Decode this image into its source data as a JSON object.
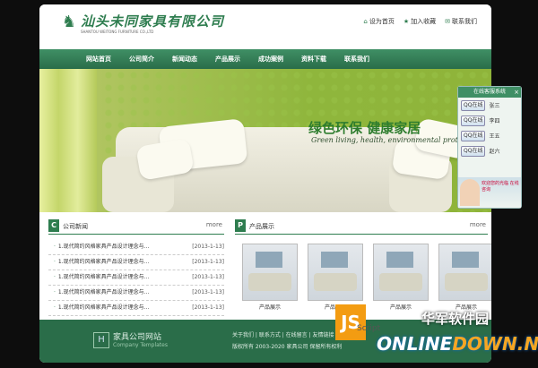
{
  "header": {
    "site_title": "汕头未同家具有限公司",
    "site_subtitle": "SHANTOU WEITONG FURNITURE CO.,LTD",
    "links": [
      {
        "icon": "home-icon",
        "label": "设为首页"
      },
      {
        "icon": "star-icon",
        "label": "加入收藏"
      },
      {
        "icon": "mail-icon",
        "label": "联系我们"
      }
    ]
  },
  "nav": {
    "items": [
      "网站首页",
      "公司简介",
      "新闻动态",
      "产品展示",
      "成功案例",
      "资料下载",
      "联系我们"
    ]
  },
  "banner": {
    "title": "绿色环保 健康家居",
    "subtitle": "Green living, health, environmental protection"
  },
  "qq_panel": {
    "title": "在线客服系统",
    "close": "×",
    "rows": [
      {
        "button": "QQ在线",
        "name": "张三"
      },
      {
        "button": "QQ在线",
        "name": "李四"
      },
      {
        "button": "QQ在线",
        "name": "王五"
      },
      {
        "button": "QQ在线",
        "name": "赵六"
      }
    ],
    "message": "欢迎您的光临 在线咨询"
  },
  "news": {
    "badge": "C",
    "title": "公司新闻",
    "more": "more",
    "items": [
      {
        "title": "1.现代简约风格家具产品设计理念与...",
        "date": "[2013-1-13]"
      },
      {
        "title": "1.现代简约风格家具产品设计理念与...",
        "date": "[2013-1-13]"
      },
      {
        "title": "1.现代简约风格家具产品设计理念与...",
        "date": "[2013-1-13]"
      },
      {
        "title": "1.现代简约风格家具产品设计理念与...",
        "date": "[2013-1-13]"
      },
      {
        "title": "1.现代简约风格家具产品设计理念与...",
        "date": "[2013-1-13]"
      }
    ]
  },
  "products": {
    "badge": "P",
    "title": "产品展示",
    "more": "more",
    "items": [
      {
        "caption": "产品展示"
      },
      {
        "caption": "产品展示"
      },
      {
        "caption": "产品展示"
      },
      {
        "caption": "产品展示"
      }
    ]
  },
  "footer": {
    "logo": "H",
    "name": "家具公司网站",
    "tagline": "Company Templates",
    "links": "关于我们 | 联系方式 | 在线留言 | 友情链接",
    "copyright": "版权所有 2003-2020 家具公司 保留所有权利"
  },
  "watermark": {
    "cn": "华军软件园",
    "en_prefix": "ONLINE",
    "en_suffix": "DOWN.NET",
    "js": "JS",
    "script": "Script"
  }
}
